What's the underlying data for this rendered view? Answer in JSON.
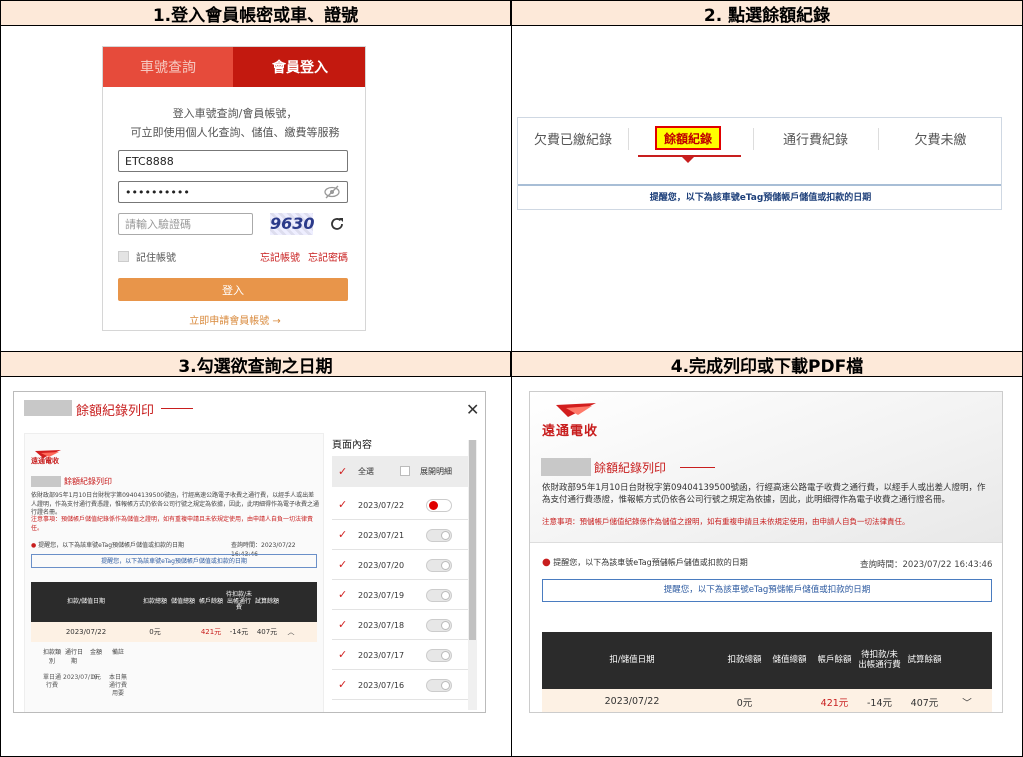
{
  "steps": [
    {
      "title": "1.登入會員帳密或車、證號"
    },
    {
      "title": "2. 點選餘額紀錄"
    },
    {
      "title": "3.勾選欲查詢之日期"
    },
    {
      "title": "4.完成列印或下載PDF檔"
    }
  ],
  "login": {
    "tab_plate": "車號查詢",
    "tab_member": "會員登入",
    "intro_line1": "登入車號查詢/會員帳號，",
    "intro_line2": "可立即使用個人化查詢、儲值、繳費等服務",
    "username_value": "ETC8888",
    "password_value": "••••••••••",
    "captcha_placeholder": "請輸入驗證碼",
    "captcha_code": "9630",
    "remember_label": "記住帳號",
    "forgot_account": "忘記帳號",
    "forgot_password": "忘記密碼",
    "login_button": "登入",
    "register_link": "立即申請會員帳號 →"
  },
  "records_tabs": {
    "tabs": [
      "欠費已繳紀錄",
      "餘額紀錄",
      "通行費紀錄",
      "欠費未繳"
    ],
    "notice": "提醒您，以下為該車號eTag預儲帳戶儲值或扣款的日期"
  },
  "print_dialog": {
    "title": "餘額紀錄列印",
    "panel_title": "頁面內容",
    "select_all": "全選",
    "expand_detail": "展開明細",
    "dates": [
      "2023/07/22",
      "2023/07/21",
      "2023/07/20",
      "2023/07/19",
      "2023/07/18",
      "2023/07/17",
      "2023/07/16"
    ],
    "preview": {
      "logo_text": "遠通電收",
      "heading": "餘額紀錄列印",
      "law_text": "依財政部95年1月10日台財稅字第09404139500號函，行經高速公路電子收費之通行費，以經手人或出差人證明，作為支付通行費憑證，惟報帳方式仍依各公司行號之規定為依據，因此，此明細得作為電子收費之通行證名冊。",
      "notice_note": "注意事項：預儲帳戶儲值紀錄係作為儲值之證明，如有重複申請且未依規定使用，由申請人自負一切法律責任。",
      "reminder": "提醒您，以下為該車號eTag預儲帳戶儲值或扣款的日期",
      "query_time": "查詢時間：2023/07/22 16:43:46",
      "blue_notice": "提醒您，以下為該車號eTag預儲帳戶儲值或扣款的日期",
      "columns": [
        "扣款/儲值日期",
        "扣款總額",
        "儲值總額",
        "帳戶餘額",
        "待扣款/未出帳通行費",
        "試算餘額"
      ],
      "row": {
        "date": "2023/07/22",
        "deduct": "0元",
        "stored": "",
        "balance": "421元",
        "pending": "-14元",
        "trial": "407元"
      },
      "sub_columns": [
        "扣款類別",
        "通行日期",
        "金額",
        "備註"
      ],
      "sub_row": {
        "type": "單日通行費",
        "date": "2023/07/19",
        "amount": "0元",
        "note": "本日無通行費用要"
      }
    }
  },
  "final_doc": {
    "logo_text": "遠通電收",
    "heading": "餘額紀錄列印",
    "law_text": "依財政部95年1月10日台財稅字第09404139500號函，行經高速公路電子收費之通行費，以經手人或出差人證明，作為支付通行費憑證，惟報帳方式仍依各公司行號之規定為依據，因此，此明細得作為電子收費之通行證名冊。",
    "notice_note": "注意事項：預儲帳戶儲值紀錄係作為儲值之證明，如有重複申請且未依規定使用，由申請人自負一切法律責任。",
    "reminder": "提醒您，以下為該車號eTag預儲帳戶儲值或扣款的日期",
    "query_time": "查詢時間：2023/07/22 16:43:46",
    "blue_notice": "提醒您，以下為該車號eTag預儲帳戶儲值或扣款的日期",
    "columns": [
      "扣/儲值日期",
      "扣款總額",
      "儲值總額",
      "帳戶餘額",
      "待扣款/未出帳通行費",
      "試算餘額"
    ],
    "row": {
      "date": "2023/07/22",
      "deduct": "0元",
      "balance": "421元",
      "pending": "-14元",
      "trial": "407元"
    }
  }
}
